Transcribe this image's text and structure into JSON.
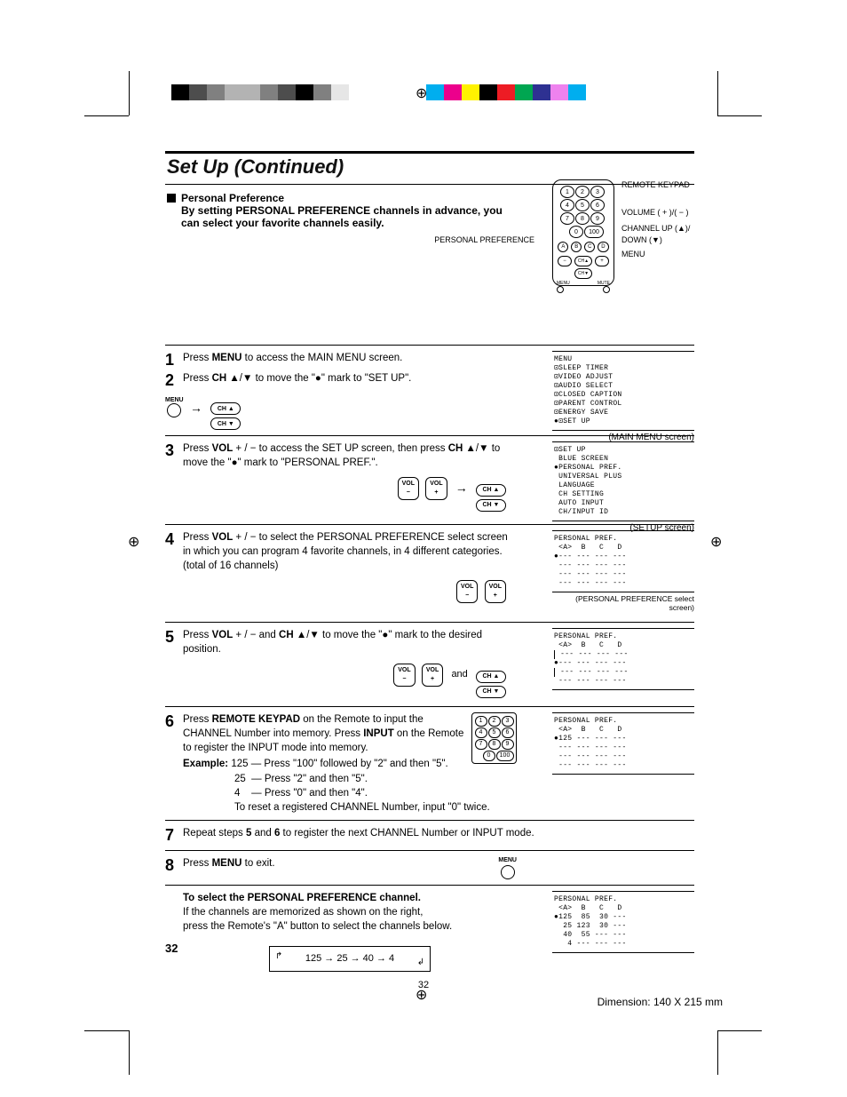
{
  "page": {
    "title": "Set Up (Continued)",
    "number": "32",
    "footer_center": "32",
    "dimension": "Dimension: 140  X 215 mm"
  },
  "intro": {
    "heading": "Personal Preference",
    "body_prefix": "By setting ",
    "body_strong": "PERSONAL PREFERENCE",
    "body_suffix": " channels in advance, you can select your favorite channels easily."
  },
  "remote_callouts": {
    "pp_label": "PERSONAL PREFERENCE",
    "keypad": "REMOTE KEYPAD",
    "volume": "VOLUME ( + )/( − )",
    "channel": "CHANNEL UP (▲)/ DOWN (▼)",
    "menu": "MENU"
  },
  "steps": {
    "s1": {
      "num": "1",
      "text_a": "Press ",
      "text_b": "MENU",
      "text_c": " to access the MAIN MENU screen."
    },
    "s2": {
      "num": "2",
      "text_a": "Press ",
      "text_b": "CH",
      "text_c": " ▲/▼ to move the \"●\" mark to \"SET UP\"."
    },
    "s3": {
      "num": "3",
      "text_a": "Press ",
      "text_b": "VOL",
      "text_c": " + / − to access the SET UP screen, then press ",
      "text_d": "CH",
      "text_e": " ▲/▼ to move the \"●\" mark to \"PERSONAL PREF.\"."
    },
    "s4": {
      "num": "4",
      "text_a": "Press ",
      "text_b": "VOL",
      "text_c": " + / − to select the PERSONAL PREFERENCE select screen in which you can program 4 favorite channels, in 4 different categories. (total of 16 channels)"
    },
    "s5": {
      "num": "5",
      "text_a": "Press ",
      "text_b": "VOL",
      "text_c": " + / − and ",
      "text_d": "CH",
      "text_e": " ▲/▼ to move the \"●\" mark to the desired position.",
      "and": "and"
    },
    "s6": {
      "num": "6",
      "text_a": "Press ",
      "text_b": "REMOTE KEYPAD",
      "text_c": " on the Remote to input the CHANNEL Number into memory. Press ",
      "text_d": "INPUT",
      "text_e": " on the Remote to register the INPUT mode into memory.",
      "example_label": "Example:",
      "ex_l1": " 125 — Press \"100\" followed by \"2\" and then \"5\".",
      "ex_l2": "25  — Press \"2\" and then \"5\".",
      "ex_l3": "4    — Press \"0\" and then \"4\".",
      "ex_l4": "To reset a registered CHANNEL Number, input \"0\" twice."
    },
    "s7": {
      "num": "7",
      "text_a": "Repeat steps ",
      "text_b": "5",
      "text_c": " and ",
      "text_d": "6",
      "text_e": " to register the next CHANNEL Number or INPUT mode."
    },
    "s8": {
      "num": "8",
      "text_a": "Press ",
      "text_b": "MENU",
      "text_c": " to exit."
    },
    "select": {
      "heading": "To select the PERSONAL PREFERENCE channel.",
      "l1": "If the channels are memorized as shown on the right,",
      "l2": "press the Remote's \"A\" button to select the channels below.",
      "cycle": "125 → 25 → 40 → 4"
    }
  },
  "osd": {
    "main_title": "MENU",
    "main_items": "⊡SLEEP TIMER\n⊡VIDEO ADJUST\n⊡AUDIO SELECT\n⊡CLOSED CAPTION\n⊡PARENT CONTROL\n⊡ENERGY SAVE\n●⊡SET UP",
    "main_caption": "(MAIN MENU screen)",
    "setup_title": "⊡SET UP",
    "setup_items": " BLUE SCREEN\n●PERSONAL PREF.\n UNIVERSAL PLUS\n LANGUAGE\n CH SETTING\n AUTO INPUT\n CH/INPUT ID",
    "setup_caption": "(SETUP screen)",
    "pp_title": "PERSONAL PREF.",
    "pp_header": " <A>  B   C   D",
    "pp_blank1": "●--- --- --- ---",
    "pp_blankN": " --- --- --- ---",
    "pp_select_caption": "(PERSONAL PREFERENCE select screen)",
    "pp6_l1": "●125 --- --- ---",
    "ppS_l1": "●125  85  30 ---",
    "ppS_l2": "  25 123  30 ---",
    "ppS_l3": "  40  55 --- ---",
    "ppS_l4": "   4 --- --- ---"
  },
  "btns": {
    "menu": "MENU",
    "ch_up": "CH ▲",
    "ch_dn": "CH ▼",
    "vol_minus_top": "VOL",
    "vol_minus_bot": "−",
    "vol_plus_top": "VOL",
    "vol_plus_bot": "+"
  },
  "keypad": {
    "1": "1",
    "2": "2",
    "3": "3",
    "4": "4",
    "5": "5",
    "6": "6",
    "7": "7",
    "8": "8",
    "9": "9",
    "0": "0",
    "100": "100"
  }
}
